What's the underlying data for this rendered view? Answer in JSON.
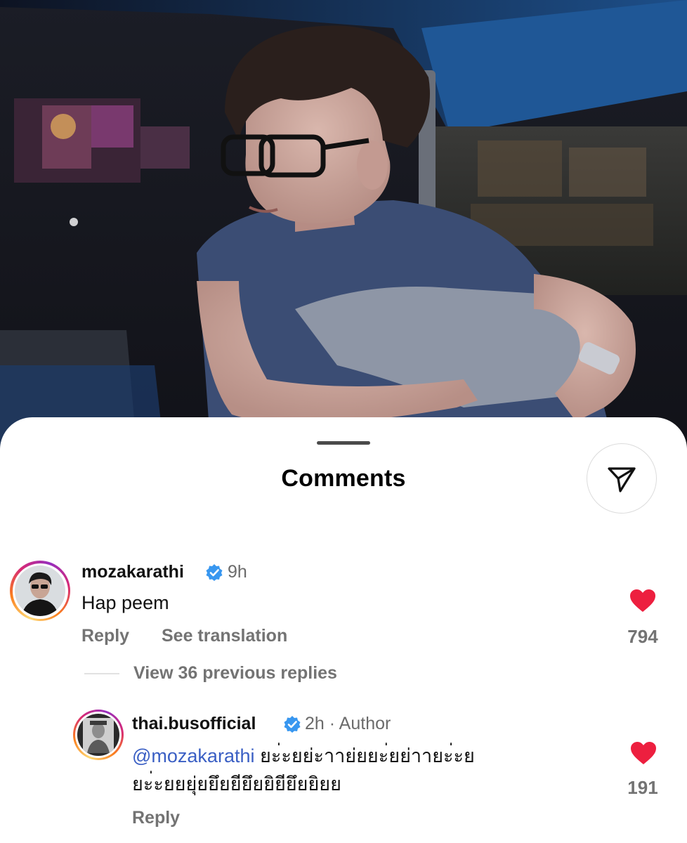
{
  "sheet": {
    "title": "Comments",
    "share_icon": "paper-plane-icon"
  },
  "comments": [
    {
      "username": "mozakarathi",
      "verified": true,
      "time": "9h",
      "text": "Hap peem",
      "reply_label": "Reply",
      "translate_label": "See translation",
      "likes": "794",
      "liked": true
    }
  ],
  "view_replies": "View 36 previous replies",
  "reply": {
    "username": "thai.busofficial",
    "verified": true,
    "time": "2h",
    "separator": "·",
    "badge": "Author",
    "mention": "@mozakarathi",
    "text_line1": "ยะ่ะยย่ะาาย่ยยะ่ยย่าายะ่ะย",
    "text_line2": "ยะ่ะยยยุ่ยยึยยียึยยิยียึยยิยย",
    "reply_label": "Reply",
    "likes": "191",
    "liked": true
  },
  "colors": {
    "heart": "#ed1f3f",
    "verified": "#3897f0",
    "mention": "#3a5fc4",
    "secondary_text": "#737373"
  }
}
